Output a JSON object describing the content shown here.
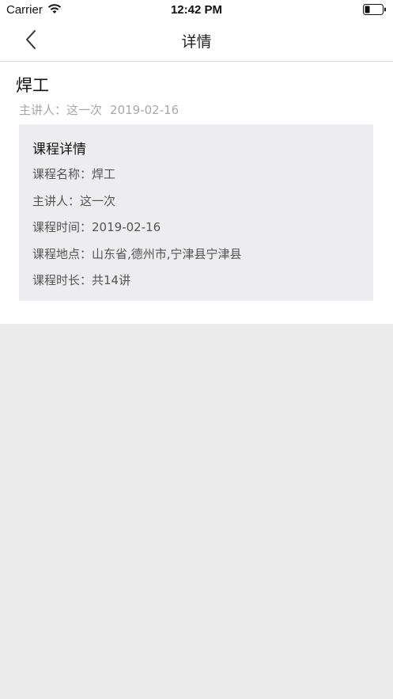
{
  "status_bar": {
    "carrier": "Carrier",
    "time": "12:42 PM",
    "icons": [
      "wifi-icon",
      "battery-icon"
    ]
  },
  "nav": {
    "title": "详情",
    "back_icon": "chevron-left-icon"
  },
  "course": {
    "title": "焊工",
    "lecturer_label": "主讲人：",
    "lecturer": "这一次",
    "date": "2019-02-16"
  },
  "details": {
    "heading": "课程详情",
    "rows": [
      {
        "label": "课程名称：",
        "value": "焊工"
      },
      {
        "label": "主讲人：",
        "value": "这一次"
      },
      {
        "label": "课程时间：",
        "value": "2019-02-16"
      },
      {
        "label": "课程地点：",
        "value": "山东省,德州市,宁津县宁津县"
      },
      {
        "label": "课程时长：",
        "value": "共14讲"
      }
    ]
  }
}
